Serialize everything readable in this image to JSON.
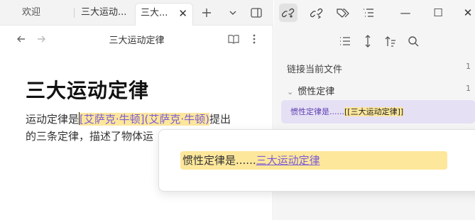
{
  "tabs": [
    {
      "label": "欢迎"
    },
    {
      "label": "三大运动..."
    },
    {
      "label": "三大..."
    }
  ],
  "tab_close_glyph": "✕",
  "tab_actions": {
    "new_tab_icon": "plus-icon",
    "list_tabs_icon": "chevron-down-icon",
    "sidebar_toggle_icon": "sidebar-toggle-icon"
  },
  "nav": {
    "title": "三大运动定律",
    "back_icon": "arrow-left-icon",
    "forward_icon": "arrow-right-icon",
    "reading_icon": "book-open-icon",
    "more_icon": "more-vertical-icon"
  },
  "document": {
    "title": "三大运动定律",
    "para_prefix": "运动定律是",
    "link_text": "[艾萨克·牛顿](艾萨克·牛顿)",
    "para_suffix_line1": "提出",
    "para_line2": "的三条定律，描述了物体运"
  },
  "right_panel": {
    "top_icons": [
      "backlinks-icon",
      "outgoing-links-icon",
      "tags-icon",
      "outline-icon"
    ],
    "window_controls": {
      "minimize": "—",
      "maximize": "☐",
      "close": "✕"
    },
    "toolbar_icons": [
      "list-icon",
      "collapse-expand-icon",
      "sort-icon",
      "search-icon"
    ],
    "backlinks_heading": "链接当前文件",
    "backlinks_count": "1",
    "file_name": "惯性定律",
    "file_count": "1",
    "match_prefix": "惯性定律是......",
    "match_highlight": "[[三大运动定律]]"
  },
  "popover": {
    "prefix": "惯性定律是......",
    "link": "三大运动定律"
  },
  "colors": {
    "highlight": "#fde79b",
    "link": "#7b5cd6",
    "match_bg": "#e6e0f5"
  }
}
